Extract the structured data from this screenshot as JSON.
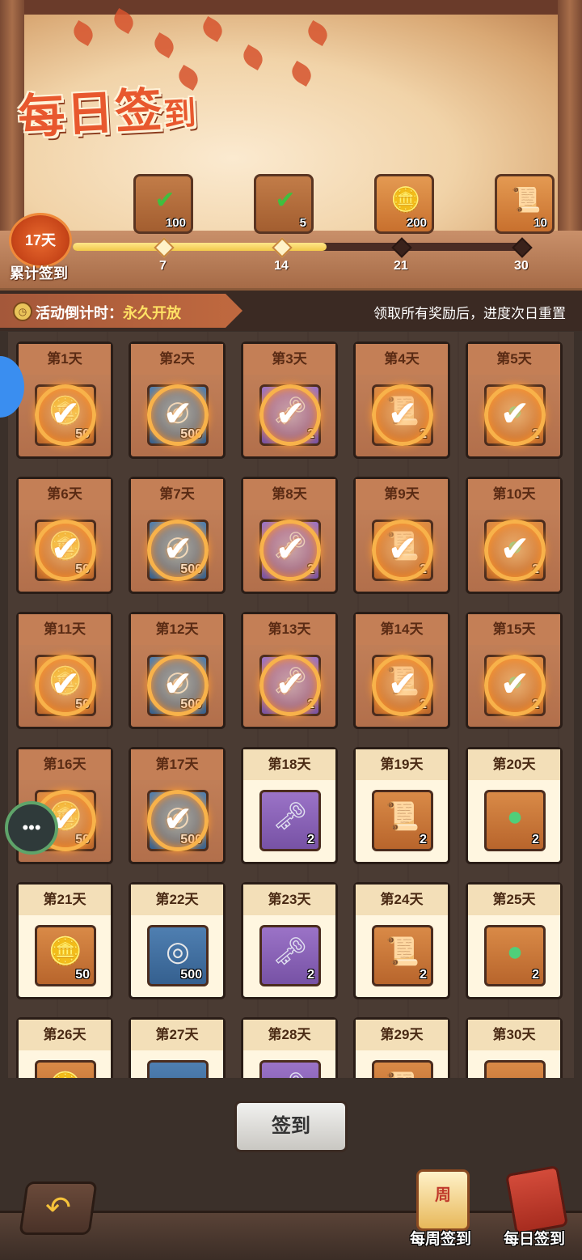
{
  "banner": {
    "title_main": "每日签",
    "title_tail": "到",
    "days_total": "17天",
    "days_label": "累计签到",
    "progress_fraction": 0.56
  },
  "milestones": [
    {
      "day": "7",
      "count": "100",
      "icon": "green-check-box-icon",
      "reached": true
    },
    {
      "day": "14",
      "count": "5",
      "icon": "green-check-scroll-icon",
      "reached": true
    },
    {
      "day": "21",
      "count": "200",
      "icon": "gold-ingot-icon",
      "reached": false
    },
    {
      "day": "30",
      "count": "10",
      "icon": "scroll-badge-icon",
      "reached": false
    }
  ],
  "info": {
    "countdown_label": "活动倒计时：",
    "countdown_value": "永久开放",
    "note": "领取所有奖励后，进度次日重置"
  },
  "days": [
    {
      "label": "第1天",
      "claimed": true,
      "color": "orange",
      "icon": "gold-ingot-icon",
      "count": "50"
    },
    {
      "label": "第2天",
      "claimed": true,
      "color": "blue",
      "icon": "coin-icon",
      "count": "500"
    },
    {
      "label": "第3天",
      "claimed": true,
      "color": "purple",
      "icon": "key-icon",
      "count": "2"
    },
    {
      "label": "第4天",
      "claimed": true,
      "color": "orange",
      "icon": "scroll-badge-icon",
      "count": "2"
    },
    {
      "label": "第5天",
      "claimed": true,
      "color": "orange",
      "icon": "green-orb-icon",
      "count": "2"
    },
    {
      "label": "第6天",
      "claimed": true,
      "color": "orange",
      "icon": "gold-ingot-icon",
      "count": "50"
    },
    {
      "label": "第7天",
      "claimed": true,
      "color": "blue",
      "icon": "coin-icon",
      "count": "500"
    },
    {
      "label": "第8天",
      "claimed": true,
      "color": "purple",
      "icon": "key-icon",
      "count": "2"
    },
    {
      "label": "第9天",
      "claimed": true,
      "color": "orange",
      "icon": "scroll-badge-icon",
      "count": "2"
    },
    {
      "label": "第10天",
      "claimed": true,
      "color": "orange",
      "icon": "green-orb-icon",
      "count": "2"
    },
    {
      "label": "第11天",
      "claimed": true,
      "color": "orange",
      "icon": "gold-ingot-icon",
      "count": "50"
    },
    {
      "label": "第12天",
      "claimed": true,
      "color": "blue",
      "icon": "coin-icon",
      "count": "500"
    },
    {
      "label": "第13天",
      "claimed": true,
      "color": "purple",
      "icon": "key-icon",
      "count": "2"
    },
    {
      "label": "第14天",
      "claimed": true,
      "color": "orange",
      "icon": "scroll-badge-icon",
      "count": "2"
    },
    {
      "label": "第15天",
      "claimed": true,
      "color": "orange",
      "icon": "green-orb-icon",
      "count": "2"
    },
    {
      "label": "第16天",
      "claimed": true,
      "color": "orange",
      "icon": "gold-ingot-icon",
      "count": "50"
    },
    {
      "label": "第17天",
      "claimed": true,
      "color": "blue",
      "icon": "coin-icon",
      "count": "500"
    },
    {
      "label": "第18天",
      "claimed": false,
      "color": "purple",
      "icon": "key-icon",
      "count": "2"
    },
    {
      "label": "第19天",
      "claimed": false,
      "color": "orange",
      "icon": "scroll-badge-icon",
      "count": "2"
    },
    {
      "label": "第20天",
      "claimed": false,
      "color": "orange",
      "icon": "green-orb-icon",
      "count": "2"
    },
    {
      "label": "第21天",
      "claimed": false,
      "color": "orange",
      "icon": "gold-ingot-icon",
      "count": "50"
    },
    {
      "label": "第22天",
      "claimed": false,
      "color": "blue",
      "icon": "coin-icon",
      "count": "500"
    },
    {
      "label": "第23天",
      "claimed": false,
      "color": "purple",
      "icon": "key-icon",
      "count": "2"
    },
    {
      "label": "第24天",
      "claimed": false,
      "color": "orange",
      "icon": "scroll-badge-icon",
      "count": "2"
    },
    {
      "label": "第25天",
      "claimed": false,
      "color": "orange",
      "icon": "green-orb-icon",
      "count": "2"
    },
    {
      "label": "第26天",
      "claimed": false,
      "color": "orange",
      "icon": "gold-ingot-icon",
      "count": ""
    },
    {
      "label": "第27天",
      "claimed": false,
      "color": "blue",
      "icon": "coin-icon",
      "count": ""
    },
    {
      "label": "第28天",
      "claimed": false,
      "color": "purple",
      "icon": "key-icon",
      "count": ""
    },
    {
      "label": "第29天",
      "claimed": false,
      "color": "orange",
      "icon": "scroll-badge-icon",
      "count": ""
    },
    {
      "label": "第30天",
      "claimed": false,
      "color": "orange",
      "icon": "green-orb-icon",
      "count": ""
    }
  ],
  "signin_button": "签到",
  "nav": {
    "weekly": "每周签到",
    "weekly_icon_text": "周",
    "daily": "每日签到"
  },
  "chat_icon": "chat-bubble-icon",
  "back_icon": "back-arrow-icon"
}
